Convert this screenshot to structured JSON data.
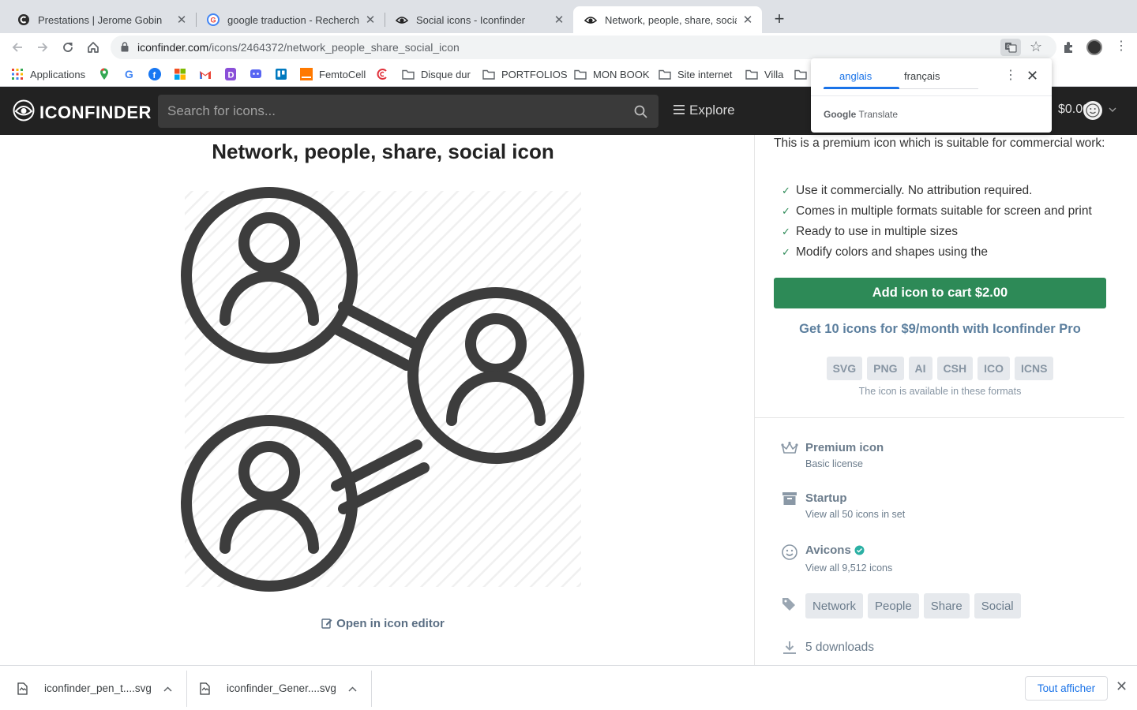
{
  "browser": {
    "tabs": [
      {
        "title": "Prestations | Jerome Gobin",
        "favicon": "c-logo-icon"
      },
      {
        "title": "google traduction - Recherche",
        "favicon": "google-icon"
      },
      {
        "title": "Social icons - Iconfinder",
        "favicon": "iconfinder-icon"
      },
      {
        "title": "Network, people, share, social",
        "favicon": "iconfinder-icon",
        "active": true
      }
    ],
    "new_tab": "+",
    "close_glyph": "✕",
    "url_domain": "iconfinder.com",
    "url_path": "/icons/2464372/network_people_share_social_icon",
    "bookmarks": [
      "Applications",
      "FemtoCell",
      "Disque dur",
      "PORTFOLIOS",
      "MON BOOK",
      "Site internet",
      "Villa"
    ]
  },
  "translate_popup": {
    "source_lang": "anglais",
    "target_lang": "français",
    "brand": "Google",
    "product": "Translate"
  },
  "site": {
    "logo_text": "ICONFINDER",
    "search_placeholder": "Search for icons...",
    "explore_label": "Explore",
    "cart_total": "$0.00"
  },
  "icon_page": {
    "title": "Network, people, share, social icon",
    "editor_link": "Open in icon editor",
    "premium_text": "This is a premium icon which is suitable for commercial work:",
    "features": [
      "Use it commercially. No attribution required.",
      "Comes in multiple formats suitable for screen and print",
      "Ready to use in multiple sizes",
      "Modify colors and shapes using the"
    ],
    "cart_button": "Add icon to cart $2.00",
    "pro_link": "Get 10 icons for $9/month with Iconfinder Pro",
    "formats": [
      "SVG",
      "PNG",
      "AI",
      "CSH",
      "ICO",
      "ICNS"
    ],
    "formats_note": "The icon is available in these formats",
    "license": {
      "title": "Premium icon",
      "sub": "Basic license"
    },
    "iconset": {
      "title": "Startup",
      "sub": "View all 50 icons in set"
    },
    "author": {
      "title": "Avicons",
      "sub": "View all 9,512 icons"
    },
    "tags": [
      "Network",
      "People",
      "Share",
      "Social"
    ],
    "downloads": "5 downloads"
  },
  "download_bar": {
    "items": [
      "iconfinder_pen_t....svg",
      "iconfinder_Gener....svg"
    ],
    "show_all": "Tout afficher"
  },
  "colors": {
    "brand_green": "#2d8a57",
    "header_bg": "#222222",
    "accent_blue": "#1a73e8"
  }
}
